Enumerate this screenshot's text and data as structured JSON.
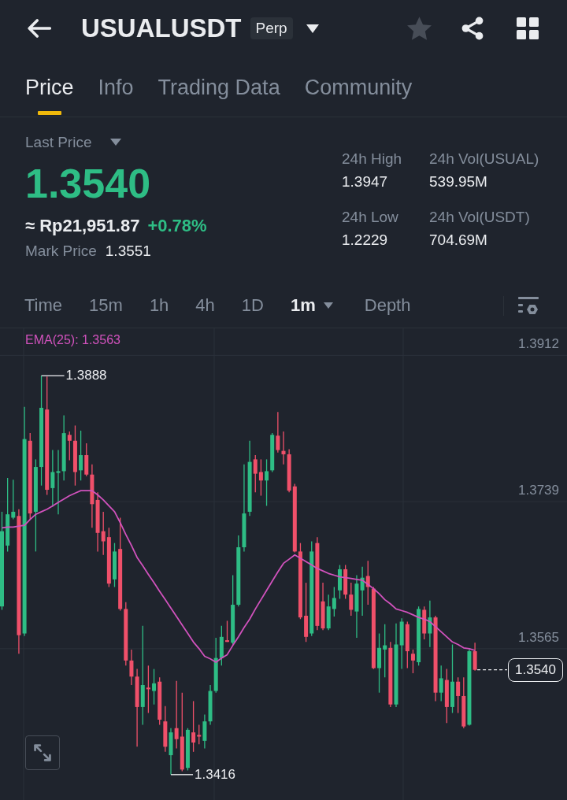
{
  "header": {
    "symbol": "USUALUSDT",
    "badge": "Perp",
    "favorite": false
  },
  "tabs": [
    {
      "label": "Price",
      "selected": true
    },
    {
      "label": "Info",
      "selected": false
    },
    {
      "label": "Trading Data",
      "selected": false
    },
    {
      "label": "Community",
      "selected": false
    }
  ],
  "price": {
    "label": "Last Price",
    "last": "1.3540",
    "rising": true,
    "fiat": "≈ Rp21,951.87",
    "change": "+0.78%",
    "mark_label": "Mark Price",
    "mark": "1.3551"
  },
  "stats": [
    {
      "label": "24h High",
      "value": "1.3947"
    },
    {
      "label": "24h Vol(USUAL)",
      "value": "539.95M"
    },
    {
      "label": "24h Low",
      "value": "1.2229"
    },
    {
      "label": "24h Vol(USDT)",
      "value": "704.69M"
    }
  ],
  "intervals": [
    {
      "label": "Time",
      "selected": false,
      "dropdown": false
    },
    {
      "label": "15m",
      "selected": false,
      "dropdown": false
    },
    {
      "label": "1h",
      "selected": false,
      "dropdown": false
    },
    {
      "label": "4h",
      "selected": false,
      "dropdown": false
    },
    {
      "label": "1D",
      "selected": false,
      "dropdown": false
    },
    {
      "label": "1m",
      "selected": true,
      "dropdown": true
    },
    {
      "label": "Depth",
      "selected": false,
      "dropdown": false
    }
  ],
  "chart": {
    "high_label": "1.3888",
    "low_label": "1.3416",
    "last_price": "1.3540",
    "chart_data": {
      "type": "candlestick",
      "grid": true,
      "ylim": [
        1.3386,
        1.3944
      ],
      "yticks": [
        {
          "value": 1.3912,
          "label": "1.3912"
        },
        {
          "value": 1.3739,
          "label": "1.3739"
        },
        {
          "value": 1.3565,
          "label": "1.3565"
        }
      ],
      "ohlc": [
        [
          1.3615,
          1.3727,
          1.3611,
          1.3704
        ],
        [
          1.3687,
          1.3767,
          1.368,
          1.3724
        ],
        [
          1.372,
          1.3765,
          1.3718,
          1.3727
        ],
        [
          1.3722,
          1.373,
          1.3559,
          1.3581
        ],
        [
          1.3583,
          1.3851,
          1.358,
          1.3813
        ],
        [
          1.3811,
          1.382,
          1.3718,
          1.3725
        ],
        [
          1.3727,
          1.3789,
          1.368,
          1.378
        ],
        [
          1.378,
          1.3888,
          1.3758,
          1.385
        ],
        [
          1.3848,
          1.3887,
          1.3747,
          1.3753
        ],
        [
          1.3755,
          1.38,
          1.3733,
          1.3774
        ],
        [
          1.3773,
          1.38,
          1.3724,
          1.3775
        ],
        [
          1.3775,
          1.3841,
          1.3764,
          1.382
        ],
        [
          1.3818,
          1.3822,
          1.3788,
          1.3811
        ],
        [
          1.3811,
          1.3829,
          1.3758,
          1.3774
        ],
        [
          1.3776,
          1.3823,
          1.3764,
          1.3794
        ],
        [
          1.3794,
          1.3808,
          1.3769,
          1.3771
        ],
        [
          1.3771,
          1.3783,
          1.3708,
          1.3736
        ],
        [
          1.3741,
          1.375,
          1.368,
          1.3702
        ],
        [
          1.3704,
          1.3727,
          1.3676,
          1.3692
        ],
        [
          1.3697,
          1.3708,
          1.3638,
          1.3642
        ],
        [
          1.3647,
          1.369,
          1.3638,
          1.368
        ],
        [
          1.3683,
          1.372,
          1.361,
          1.3612
        ],
        [
          1.3612,
          1.362,
          1.3545,
          1.3551
        ],
        [
          1.3551,
          1.3564,
          1.3522,
          1.3532
        ],
        [
          1.3532,
          1.3541,
          1.3449,
          1.3496
        ],
        [
          1.3496,
          1.3592,
          1.3475,
          1.3522
        ],
        [
          1.3519,
          1.3545,
          1.3489,
          1.3517
        ],
        [
          1.3515,
          1.3541,
          1.3499,
          1.3524
        ],
        [
          1.3526,
          1.3531,
          1.3475,
          1.3481
        ],
        [
          1.3479,
          1.3497,
          1.3443,
          1.3449
        ],
        [
          1.3439,
          1.3471,
          1.3416,
          1.3466
        ],
        [
          1.3471,
          1.3527,
          1.3447,
          1.3458
        ],
        [
          1.3461,
          1.3513,
          1.342,
          1.3422
        ],
        [
          1.3424,
          1.3471,
          1.3421,
          1.3469
        ],
        [
          1.3466,
          1.3503,
          1.3443,
          1.3454
        ],
        [
          1.3463,
          1.3475,
          1.3452,
          1.3461
        ],
        [
          1.3456,
          1.3487,
          1.3447,
          1.3479
        ],
        [
          1.3479,
          1.3522,
          1.3475,
          1.3515
        ],
        [
          1.3515,
          1.3578,
          1.3513,
          1.3554
        ],
        [
          1.3554,
          1.3592,
          1.3545,
          1.3579
        ],
        [
          1.3575,
          1.3598,
          1.3573,
          1.3573
        ],
        [
          1.3572,
          1.3652,
          1.357,
          1.3617
        ],
        [
          1.3617,
          1.3699,
          1.3615,
          1.3685
        ],
        [
          1.3685,
          1.3783,
          1.368,
          1.3725
        ],
        [
          1.3727,
          1.3811,
          1.3722,
          1.3786
        ],
        [
          1.3789,
          1.3794,
          1.375,
          1.3772
        ],
        [
          1.3774,
          1.3789,
          1.3746,
          1.3764
        ],
        [
          1.3764,
          1.3789,
          1.3734,
          1.3775
        ],
        [
          1.3776,
          1.382,
          1.3774,
          1.3818
        ],
        [
          1.3817,
          1.3845,
          1.3797,
          1.38
        ],
        [
          1.3799,
          1.3822,
          1.3783,
          1.3795
        ],
        [
          1.3795,
          1.3801,
          1.375,
          1.3752
        ],
        [
          1.3757,
          1.376,
          1.3679,
          1.368
        ],
        [
          1.368,
          1.369,
          1.36,
          1.3602
        ],
        [
          1.3604,
          1.3643,
          1.3573,
          1.3579
        ],
        [
          1.3583,
          1.3692,
          1.358,
          1.368
        ],
        [
          1.369,
          1.3697,
          1.3587,
          1.3592
        ],
        [
          1.3621,
          1.3643,
          1.3587,
          1.3589
        ],
        [
          1.3589,
          1.3629,
          1.3587,
          1.3615
        ],
        [
          1.3612,
          1.3638,
          1.3603,
          1.3625
        ],
        [
          1.3634,
          1.3664,
          1.3624,
          1.3659
        ],
        [
          1.3659,
          1.3664,
          1.3624,
          1.3629
        ],
        [
          1.3629,
          1.3643,
          1.3604,
          1.3611
        ],
        [
          1.3609,
          1.3652,
          1.3578,
          1.3642
        ],
        [
          1.3634,
          1.3662,
          1.3604,
          1.3649
        ],
        [
          1.3651,
          1.3669,
          1.3617,
          1.3638
        ],
        [
          1.3636,
          1.3638,
          1.3541,
          1.3542
        ],
        [
          1.3542,
          1.3583,
          1.3513,
          1.3566
        ],
        [
          1.3564,
          1.3594,
          1.3531,
          1.3569
        ],
        [
          1.3566,
          1.3573,
          1.3496,
          1.3499
        ],
        [
          1.3499,
          1.3595,
          1.3496,
          1.357
        ],
        [
          1.3569,
          1.3601,
          1.3541,
          1.3597
        ],
        [
          1.3594,
          1.3597,
          1.3542,
          1.3562
        ],
        [
          1.3559,
          1.3564,
          1.3536,
          1.3551
        ],
        [
          1.3549,
          1.3615,
          1.3545,
          1.3612
        ],
        [
          1.3611,
          1.3615,
          1.3576,
          1.3583
        ],
        [
          1.3583,
          1.3622,
          1.3567,
          1.3602
        ],
        [
          1.3602,
          1.3604,
          1.3503,
          1.3513
        ],
        [
          1.3513,
          1.3545,
          1.3503,
          1.353
        ],
        [
          1.3528,
          1.3541,
          1.3477,
          1.3496
        ],
        [
          1.3496,
          1.357,
          1.3489,
          1.3526
        ],
        [
          1.3526,
          1.3531,
          1.3489,
          1.3509
        ],
        [
          1.3509,
          1.3531,
          1.3471,
          1.3473
        ],
        [
          1.3475,
          1.3564,
          1.3474,
          1.3562
        ],
        [
          1.3562,
          1.3572,
          1.3539,
          1.354
        ]
      ],
      "series": [
        {
          "name": "EMA(25): 1.3563",
          "type": "line",
          "color": "#d152bd",
          "values": [
            1.3708,
            1.3709,
            1.3709,
            1.371,
            1.3711,
            1.3718,
            1.3724,
            1.3727,
            1.373,
            1.3734,
            1.3738,
            1.3742,
            1.3746,
            1.3749,
            1.3752,
            1.3752,
            1.3752,
            1.3747,
            1.3741,
            1.3734,
            1.3727,
            1.3714,
            1.37,
            1.3687,
            1.3673,
            1.3663,
            1.3653,
            1.3643,
            1.3633,
            1.3623,
            1.3613,
            1.3603,
            1.3593,
            1.3583,
            1.3573,
            1.3565,
            1.3556,
            1.3553,
            1.3549,
            1.3554,
            1.3558,
            1.3569,
            1.3579,
            1.359,
            1.36,
            1.3612,
            1.3623,
            1.3634,
            1.3645,
            1.3656,
            1.3666,
            1.3671,
            1.3676,
            1.3672,
            1.3668,
            1.3664,
            1.366,
            1.3657,
            1.3654,
            1.3652,
            1.365,
            1.3649,
            1.3648,
            1.3647,
            1.3646,
            1.3641,
            1.3636,
            1.363,
            1.3623,
            1.3618,
            1.3612,
            1.361,
            1.3608,
            1.3605,
            1.3602,
            1.36,
            1.3597,
            1.3591,
            1.3585,
            1.3579,
            1.3573,
            1.357,
            1.3566,
            1.3565,
            1.3563
          ]
        }
      ]
    }
  }
}
